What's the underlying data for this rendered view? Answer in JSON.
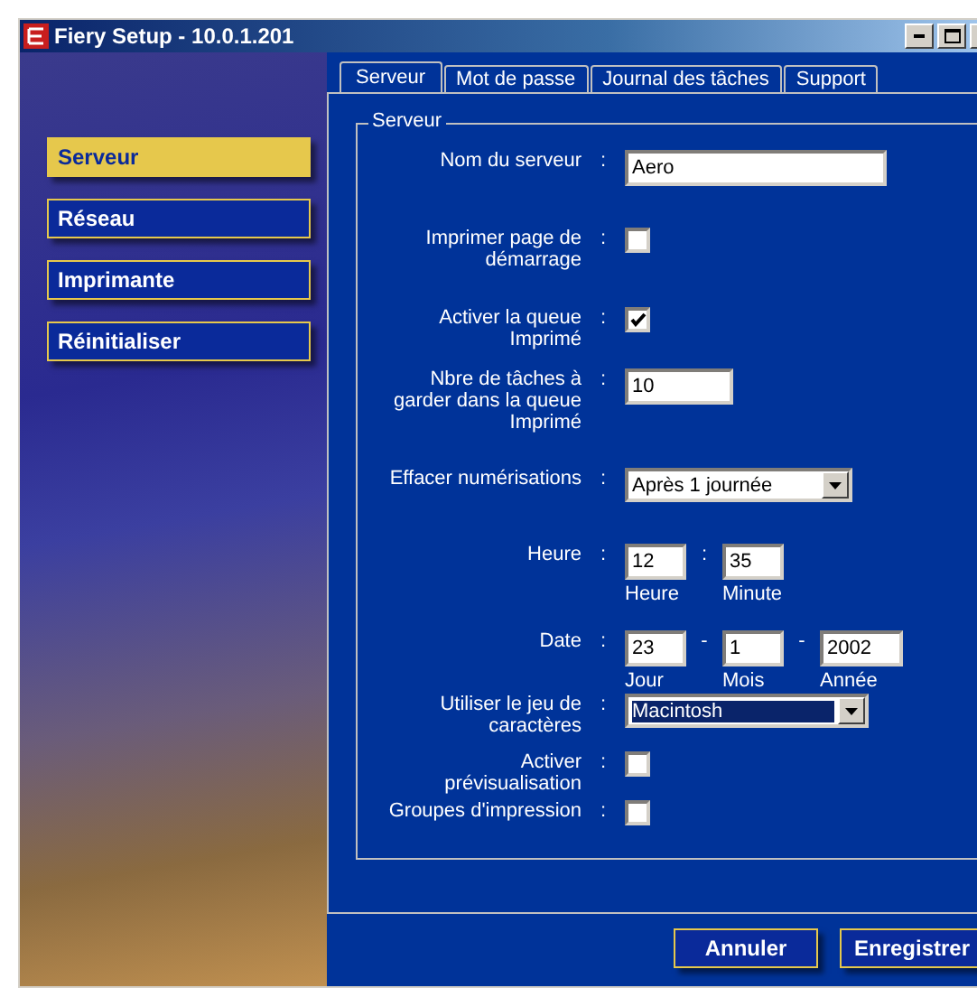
{
  "window": {
    "title": "Fiery Setup - 10.0.1.201"
  },
  "sidebar": {
    "items": [
      {
        "label": "Serveur",
        "selected": true
      },
      {
        "label": "Réseau",
        "selected": false
      },
      {
        "label": "Imprimante",
        "selected": false
      },
      {
        "label": "Réinitialiser",
        "selected": false
      }
    ]
  },
  "tabs": [
    {
      "label": "Serveur",
      "selected": true
    },
    {
      "label": "Mot de passe",
      "selected": false
    },
    {
      "label": "Journal des tâches",
      "selected": false
    },
    {
      "label": "Support",
      "selected": false
    }
  ],
  "group": {
    "title": "Serveur",
    "fields": [
      {
        "kind": "text",
        "label": "Nom du serveur",
        "colon": ":",
        "value": "Aero"
      },
      {
        "kind": "checkbox",
        "label": "Imprimer page de démarrage",
        "colon": ":",
        "checked": false
      },
      {
        "kind": "checkbox",
        "label": "Activer la queue Imprimé",
        "colon": ":",
        "checked": true
      },
      {
        "kind": "number",
        "label": "Nbre de tâches à garder dans la queue Imprimé",
        "colon": ":",
        "value": "10"
      },
      {
        "kind": "select",
        "label": "Effacer numérisations",
        "colon": ":",
        "value": "Après 1 journée",
        "focused": false
      },
      {
        "kind": "parts",
        "label": "Heure",
        "colon": ":",
        "separator": ":",
        "parts": [
          {
            "value": "12",
            "caption": "Heure"
          },
          {
            "value": "35",
            "caption": "Minute"
          }
        ]
      },
      {
        "kind": "parts",
        "label": "Date",
        "colon": ":",
        "separator": "-",
        "parts": [
          {
            "value": "23",
            "caption": "Jour"
          },
          {
            "value": "1",
            "caption": "Mois"
          },
          {
            "value": "2002",
            "caption": "Année"
          }
        ]
      },
      {
        "kind": "select",
        "label": "Utiliser le jeu de caractères",
        "colon": ":",
        "value": "Macintosh",
        "focused": true
      },
      {
        "kind": "checkbox",
        "label": "Activer prévisualisation",
        "colon": ":",
        "checked": false
      },
      {
        "kind": "checkbox",
        "label": "Groupes d'impression",
        "colon": ":",
        "checked": false
      }
    ]
  },
  "buttons": [
    "Annuler",
    "Enregistrer"
  ]
}
